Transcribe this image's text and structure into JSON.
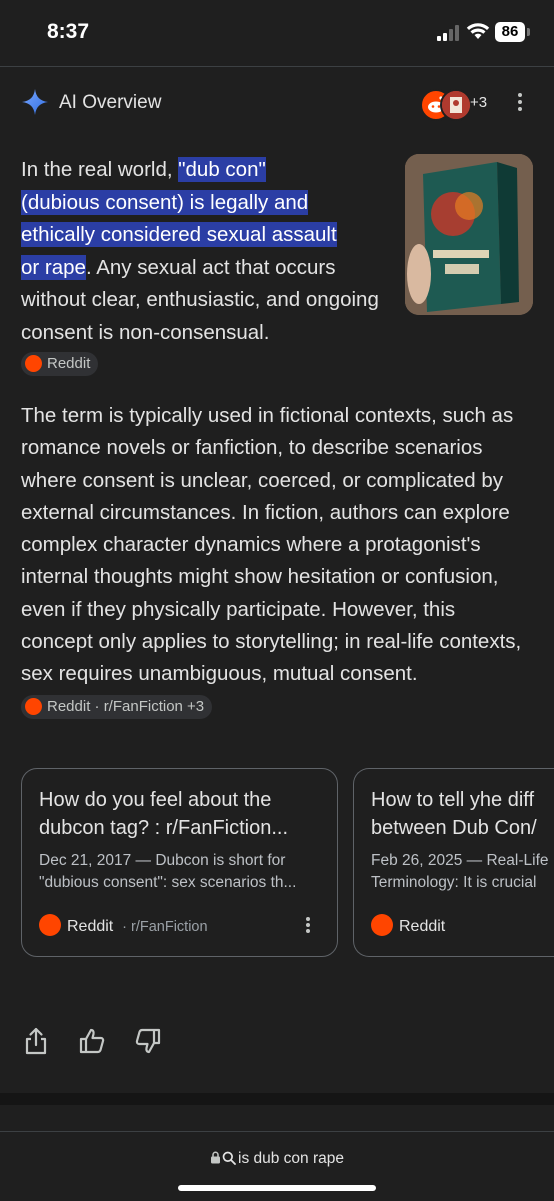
{
  "status_bar": {
    "time": "8:37",
    "battery": "86"
  },
  "header": {
    "title": "AI Overview",
    "source_count": "+3"
  },
  "overview": {
    "p1_before": "In the real world, ",
    "p1_highlight_1": "\"dub con\"",
    "p1_highlight_2": "(dubious consent) is legally and",
    "p1_highlight_3": "ethically considered sexual assault",
    "p1_highlight_4": "or rape",
    "p1_after": ". Any sexual act that occurs without clear, enthusiastic, and ongoing consent is non-consensual.",
    "chip1": "Reddit",
    "p2": "The term is typically used in fictional contexts, such as romance novels or fanfiction, to describe scenarios where consent is unclear, coerced, or complicated by external circumstances. In fiction, authors can explore complex character dynamics where a protagonist's internal thoughts might show hesitation or confusion, even if they physically participate. However, this concept only applies to storytelling; in real-life contexts, sex requires unambiguous, mutual consent.",
    "chip2": "Reddit · r/FanFiction +3"
  },
  "cards": [
    {
      "title_line1": "How do you feel about the",
      "title_line2": "dubcon tag? : r/FanFiction...",
      "snippet_line1": "Dec 21, 2017 — Dubcon is short for",
      "snippet_line2": "\"dubious consent\": sex scenarios th...",
      "source": "Reddit",
      "subsource": "· r/FanFiction"
    },
    {
      "title_line1": "How to tell yhe diff",
      "title_line2": "between Dub Con/",
      "snippet_line1": "Feb 26, 2025 — Real-Life",
      "snippet_line2": "Terminology: It is crucial",
      "source": "Reddit"
    }
  ],
  "url_bar": {
    "query": "is dub con rape"
  },
  "colors": {
    "background": "#1f1f1f",
    "highlight": "#2b3ea5",
    "reddit": "#ff4500",
    "sparkle": "#4d8df6"
  }
}
